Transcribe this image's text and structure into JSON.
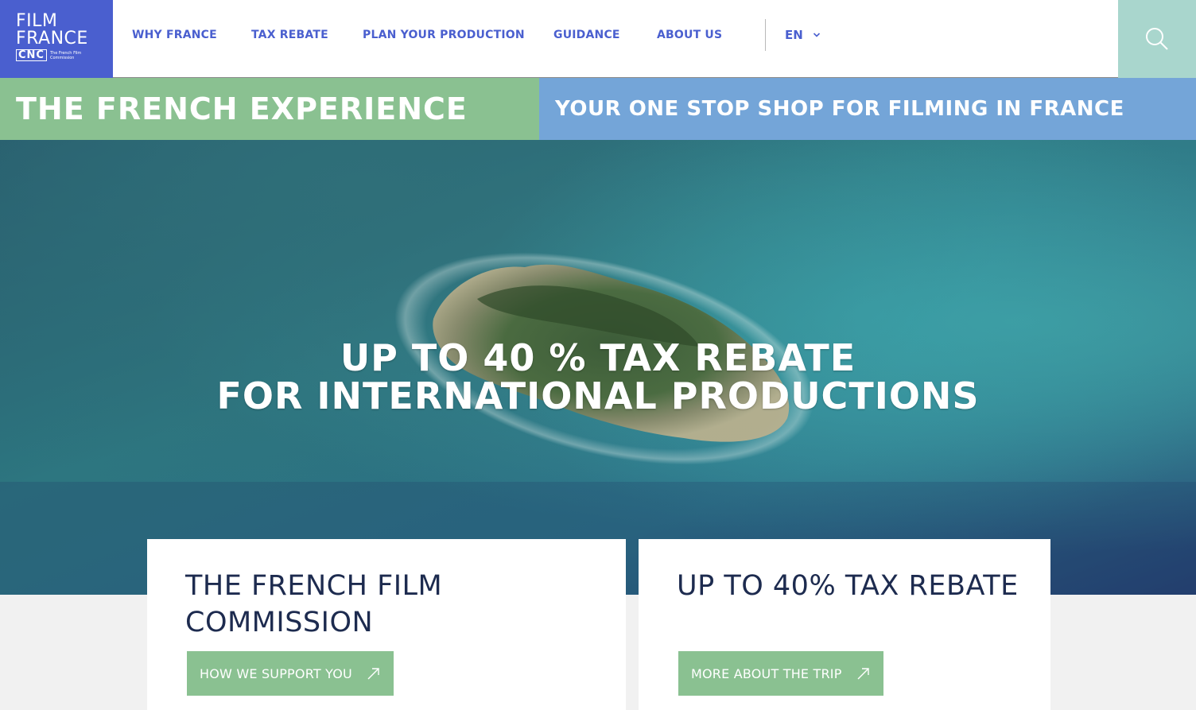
{
  "logo": {
    "line1": "FILM",
    "line2": "FRANCE",
    "brand": "CNC",
    "subtitle": "The French Film Commission"
  },
  "nav": {
    "items": [
      {
        "label": "WHY FRANCE"
      },
      {
        "label": "TAX REBATE"
      },
      {
        "label": "PLAN YOUR PRODUCTION"
      },
      {
        "label": "GUIDANCE"
      },
      {
        "label": "ABOUT US"
      }
    ],
    "language": "EN"
  },
  "banners": {
    "left": "THE FRENCH EXPERIENCE",
    "right": "YOUR ONE STOP SHOP FOR FILMING IN FRANCE"
  },
  "hero": {
    "line1": "UP TO 40 % TAX REBATE",
    "line2": "FOR INTERNATIONAL PRODUCTIONS"
  },
  "cards": [
    {
      "title_line1": "THE FRENCH FILM",
      "title_line2": "COMMISSION",
      "cta": "HOW WE SUPPORT YOU"
    },
    {
      "title_line1": "UP TO 40% TAX REBATE",
      "title_line2": "",
      "cta": "MORE ABOUT THE TRIP"
    }
  ],
  "colors": {
    "brand_blue": "#4a5fcf",
    "green": "#8ac191",
    "light_blue": "#74a5d8",
    "search_teal": "#a9d6cd",
    "dark_navy": "#1d2b4f"
  },
  "icons": {
    "search": "search-icon",
    "chevron": "chevron-down-icon",
    "arrow": "arrow-up-right-icon"
  }
}
